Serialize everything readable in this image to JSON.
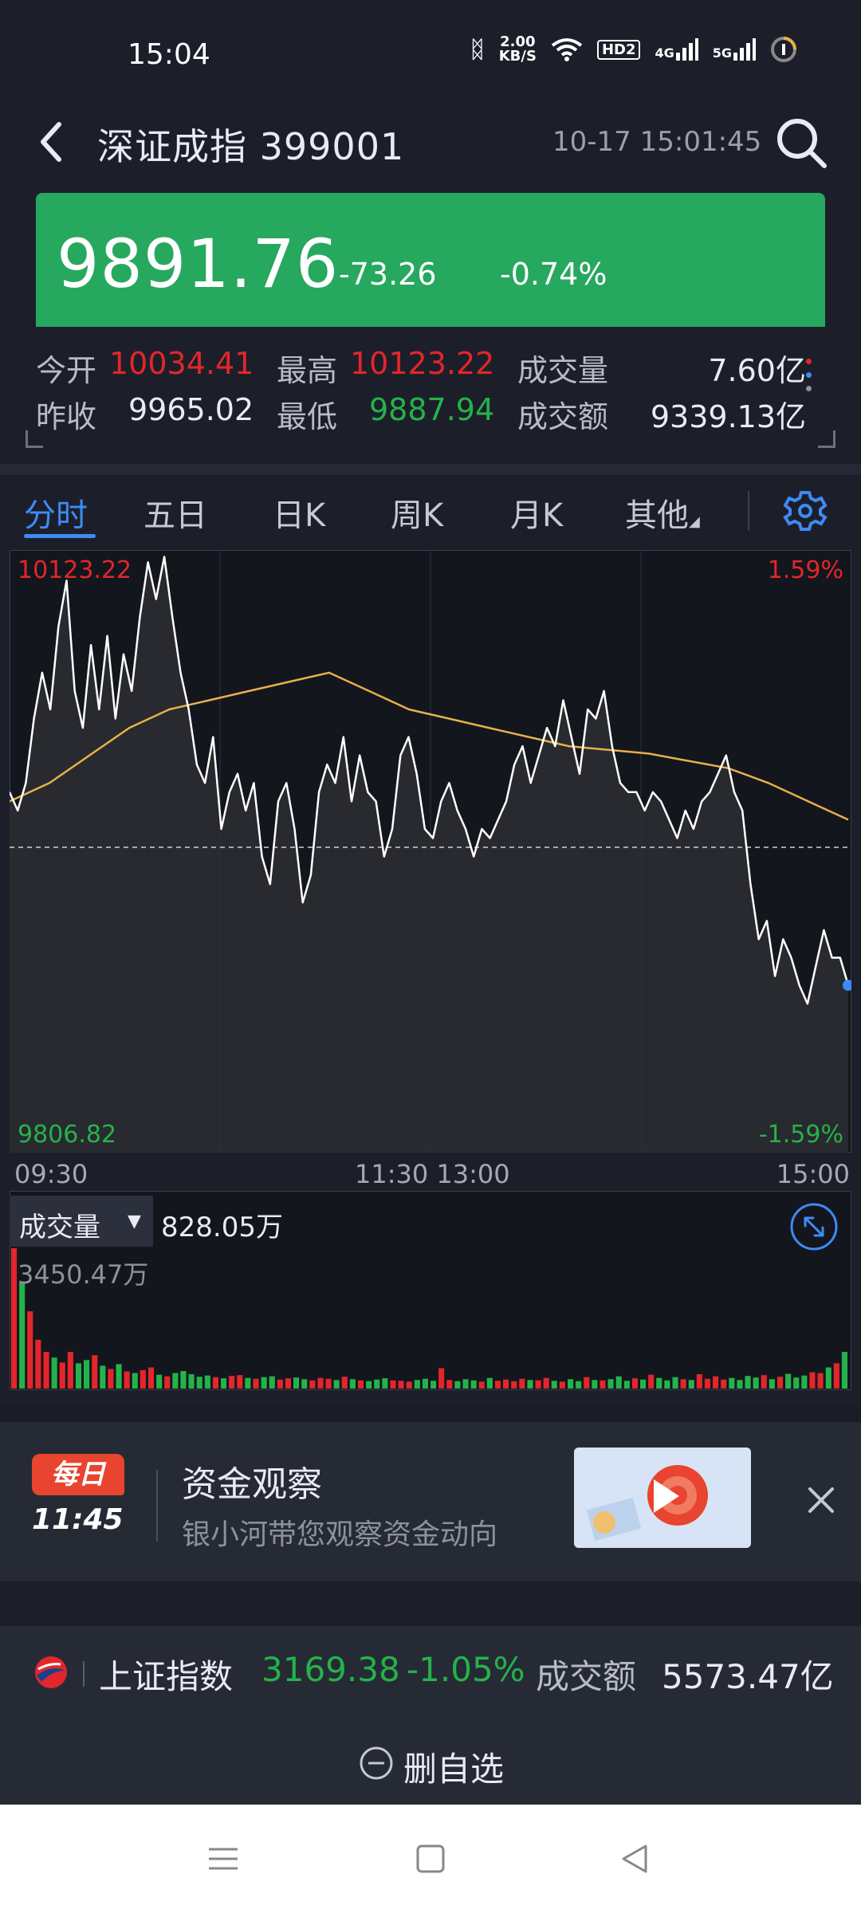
{
  "status": {
    "time": "15:04",
    "net_speed_value": "2.00",
    "net_speed_unit": "KB/S",
    "hd_label": "HD2",
    "net_4g": "4G",
    "net_5g": "5G"
  },
  "header": {
    "title": "深证成指 399001",
    "datetime": "10-17 15:01:45"
  },
  "quote": {
    "price": "9891.76",
    "change": "-73.26",
    "change_pct": "-0.74%"
  },
  "stats": {
    "open_label": "今开",
    "open_value": "10034.41",
    "high_label": "最高",
    "high_value": "10123.22",
    "volume_label": "成交量",
    "volume_value": "7.60亿",
    "prev_close_label": "昨收",
    "prev_close_value": "9965.02",
    "low_label": "最低",
    "low_value": "9887.94",
    "amount_label": "成交额",
    "amount_value": "9339.13亿"
  },
  "tabs": [
    {
      "label": "分时"
    },
    {
      "label": "五日"
    },
    {
      "label": "日K"
    },
    {
      "label": "周K"
    },
    {
      "label": "月K"
    },
    {
      "label": "其他"
    }
  ],
  "chart": {
    "price_high": "10123.22",
    "price_low": "9806.82",
    "pct_high": "1.59%",
    "pct_low": "-1.59%",
    "time_start": "09:30",
    "time_mid": "11:30 13:00",
    "time_end": "15:00"
  },
  "chart_data": {
    "type": "line",
    "ylim": [
      9806.82,
      10123.22
    ],
    "baseline": 9965.02,
    "series": [
      {
        "values": [
          9995,
          9985,
          10000,
          10035,
          10060,
          10040,
          10085,
          10110,
          10050,
          10030,
          10075,
          10040,
          10080,
          10035,
          10070,
          10050,
          10090,
          10120,
          10100,
          10123,
          10090,
          10060,
          10040,
          10010,
          10000,
          10025,
          9975,
          9995,
          10005,
          9985,
          10000,
          9960,
          9945,
          9990,
          10000,
          9975,
          9935,
          9950,
          9995,
          10010,
          10000,
          10025,
          9990,
          10015,
          9995,
          9990,
          9960,
          9975,
          10015,
          10025,
          10005,
          9975,
          9970,
          9990,
          10000,
          9985,
          9975,
          9960,
          9975,
          9970,
          9980,
          9990,
          10010,
          10020,
          10000,
          10015,
          10030,
          10020,
          10045,
          10025,
          10005,
          10040,
          10035,
          10050,
          10020,
          10000,
          9995,
          9995,
          9985,
          9995,
          9990,
          9980,
          9970,
          9985,
          9975,
          9990,
          9995,
          10005,
          10015,
          9995,
          9985,
          9945,
          9915,
          9925,
          9895,
          9915,
          9905,
          9890,
          9880,
          9900,
          9920,
          9905,
          9905,
          9890
        ],
        "avg": [
          9990,
          10000,
          10015,
          10030,
          10040,
          10045,
          10050,
          10055,
          10060,
          10050,
          10040,
          10035,
          10030,
          10025,
          10020,
          10018,
          10016,
          10012,
          10008,
          10000,
          9990,
          9980
        ]
      },
      {
        "name": "成交量",
        "values": [
          3450.47,
          2600,
          1900,
          1200,
          900,
          760,
          640,
          900,
          620,
          700,
          820,
          560,
          480,
          600,
          420,
          380,
          450,
          520,
          340,
          300,
          380,
          430,
          350,
          290,
          320,
          280,
          250,
          310,
          330,
          260,
          240,
          280,
          300,
          220,
          250,
          270,
          230,
          200,
          260,
          240,
          210,
          290,
          230,
          200,
          180,
          220,
          250,
          200,
          190,
          170,
          210,
          240,
          190,
          500,
          210,
          180,
          230,
          200,
          170,
          260,
          190,
          220,
          180,
          240,
          210,
          200,
          260,
          190,
          170,
          230,
          180,
          280,
          210,
          200,
          230,
          300,
          190,
          250,
          220,
          340,
          260,
          200,
          280,
          230,
          210,
          350,
          240,
          300,
          220,
          260,
          210,
          310,
          270,
          330,
          230,
          290,
          360,
          270,
          320,
          400,
          380,
          520,
          620,
          900
        ]
      }
    ]
  },
  "volume": {
    "label": "成交量",
    "value": "828.05万",
    "max": "3450.47万"
  },
  "banner": {
    "badge_top": "每日",
    "badge_time": "11:45",
    "title": "资金观察",
    "subtitle": "银小河带您观察资金动向"
  },
  "ticker": {
    "name": "上证指数",
    "price": "3169.38",
    "change_pct": "-1.05%",
    "amount_label": "成交额",
    "amount_value": "5573.47亿"
  },
  "action": {
    "label": "删自选"
  },
  "colors": {
    "up": "#e3262b",
    "down": "#24b34a",
    "accent": "#3d8bf5",
    "avg_line": "#e6b04a",
    "background": "#1c1f2a"
  }
}
